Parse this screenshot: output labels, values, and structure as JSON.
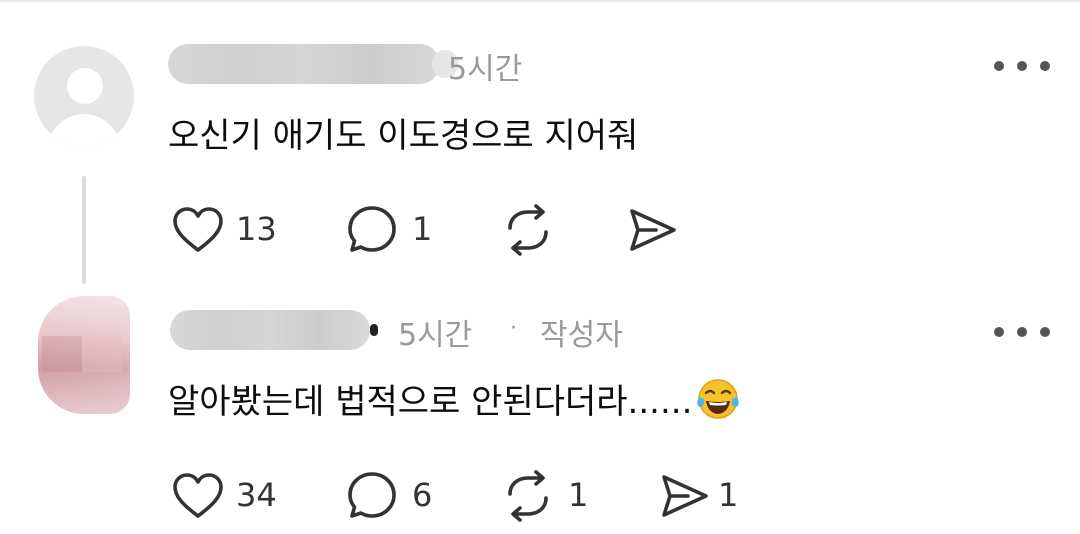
{
  "comments": [
    {
      "time": "5시간",
      "text": "오신기 애기도 이도경으로 지어줘",
      "likes": "13",
      "replies": "1",
      "reposts": "",
      "shares": ""
    },
    {
      "time": "5시간",
      "separator": "·",
      "author_badge": "작성자",
      "text": "알아봤는데 법적으로 안된다더라......",
      "emoji": "face-with-tears-of-joy",
      "likes": "34",
      "replies": "6",
      "reposts": "1",
      "shares": "1"
    }
  ],
  "icons": {
    "like": "heart-icon",
    "reply": "comment-bubble-icon",
    "repost": "repost-icon",
    "share": "send-icon",
    "more": "more-dots-icon"
  },
  "colors": {
    "meta_text": "#9a9a9a",
    "body_text": "#0d0d0d",
    "icon": "#333333"
  }
}
